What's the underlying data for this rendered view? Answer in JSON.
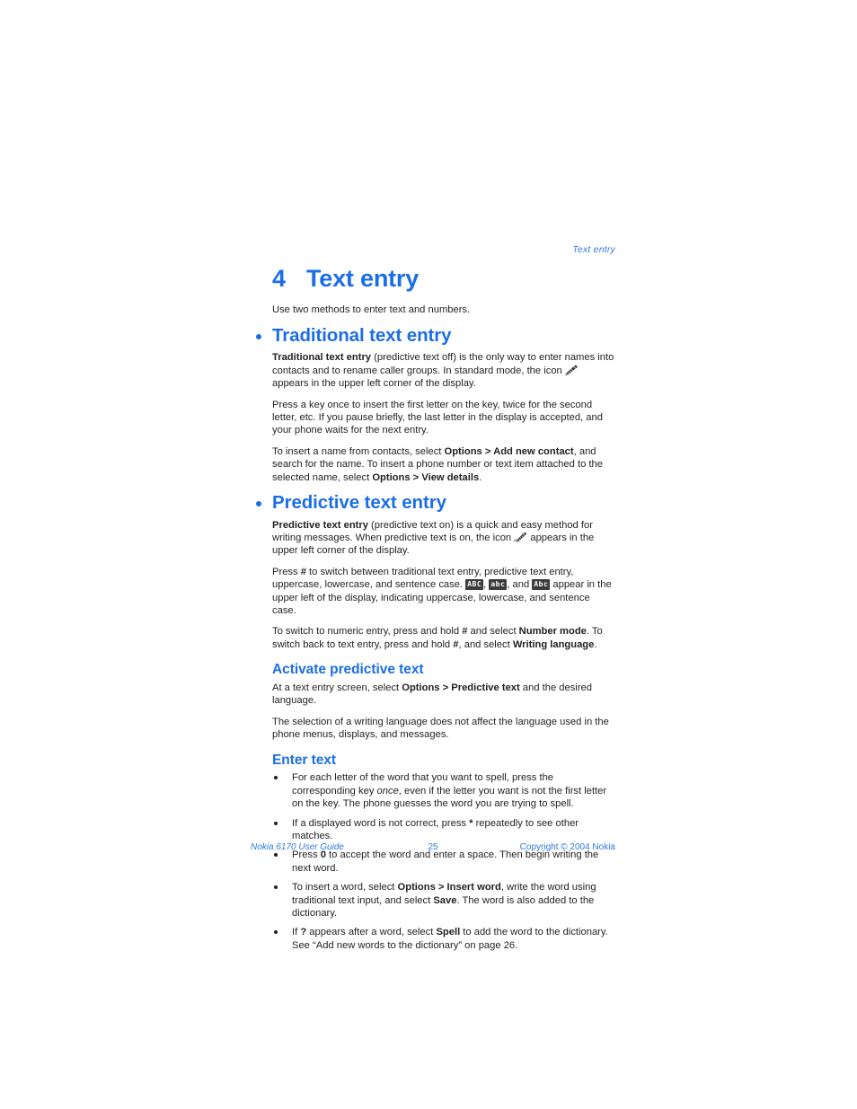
{
  "colors": {
    "heading_blue": "#1b6ee8",
    "footer_blue": "#2f7ae5",
    "body_text": "#231f20",
    "badge_bg": "#3c3c3c"
  },
  "running_head": "Text entry",
  "chapter": {
    "number": "4",
    "title": "Text entry"
  },
  "intro": "Use two methods to enter text and numbers.",
  "sections": [
    {
      "heading": "Traditional text entry",
      "paragraphs": {
        "p1_a": "Traditional text entry",
        "p1_b": " (predictive text off) is the only way to enter names into contacts and to rename caller groups. In standard mode, the icon ",
        "p1_c": " appears in the upper left corner of the display.",
        "p2": "Press a key once to insert the first letter on the key, twice for the second letter, etc. If you pause briefly, the last letter in the display is accepted, and your phone waits for the next entry.",
        "p3_a": "To insert a name from contacts, select ",
        "p3_b": "Options > Add new contact",
        "p3_c": ", and search for the name. To insert a phone number or text item attached to the selected name, select ",
        "p3_d": "Options > View details",
        "p3_e": "."
      }
    },
    {
      "heading": "Predictive text entry",
      "paragraphs": {
        "p1_a": "Predictive text entry",
        "p1_b": " (predictive text on) is a quick and easy method for writing messages. When predictive text is on, the icon ",
        "p1_c": " appears in the upper left corner of the display.",
        "p2_a": "Press ",
        "p2_b": "#",
        "p2_c": " to switch between traditional text entry, predictive text entry, uppercase, lowercase, and sentence case. ",
        "p2_badge1": "ABC",
        "p2_d": ", ",
        "p2_badge2": "abc",
        "p2_e": ", and ",
        "p2_badge3": "Abc",
        "p2_f": " appear in the upper left of the display, indicating uppercase, lowercase, and sentence case.",
        "p3_a": "To switch to numeric entry, press and hold ",
        "p3_b": "#",
        "p3_c": " and select ",
        "p3_d": "Number mode",
        "p3_e": ". To switch back to text entry, press and hold ",
        "p3_f": "#",
        "p3_g": ", and select ",
        "p3_h": "Writing language",
        "p3_i": "."
      }
    }
  ],
  "subsections": [
    {
      "heading": "Activate predictive text",
      "p1_a": "At a text entry screen, select ",
      "p1_b": "Options > Predictive text",
      "p1_c": " and the desired language.",
      "p2": "The selection of a writing language does not affect the language used in the phone menus, displays, and messages."
    },
    {
      "heading": "Enter text"
    }
  ],
  "enter_text_bullets": [
    {
      "a": "For each letter of the word that you want to spell, press the corresponding key ",
      "em": "once",
      "b": ", even if the letter you want is not the first letter on the key. The phone guesses the word you are trying to spell.",
      "c": "",
      "d": "",
      "e": ""
    },
    {
      "a": "If a displayed word is not correct, press ",
      "bold": "*",
      "b": " repeatedly to see other matches."
    },
    {
      "a": "Press ",
      "bold": "0",
      "b": " to accept the word and enter a space. Then begin writing the next word."
    },
    {
      "a": "To insert a word, select ",
      "bold": "Options > Insert word",
      "b": ", write the word using traditional text input, and select ",
      "bold2": "Save",
      "c": ". The word is also added to the dictionary."
    },
    {
      "a": "If ",
      "bold": "?",
      "b": " appears after a word, select ",
      "bold2": "Spell",
      "c": " to add the word to the dictionary. See “Add new words to the dictionary” on page 26."
    }
  ],
  "footer": {
    "left": "Nokia 6170 User Guide",
    "page_number": "25",
    "right": "Copyright © 2004 Nokia"
  },
  "icons": {
    "pencil": "pencil-icon",
    "pencil_predictive": "pencil-predictive-icon"
  }
}
